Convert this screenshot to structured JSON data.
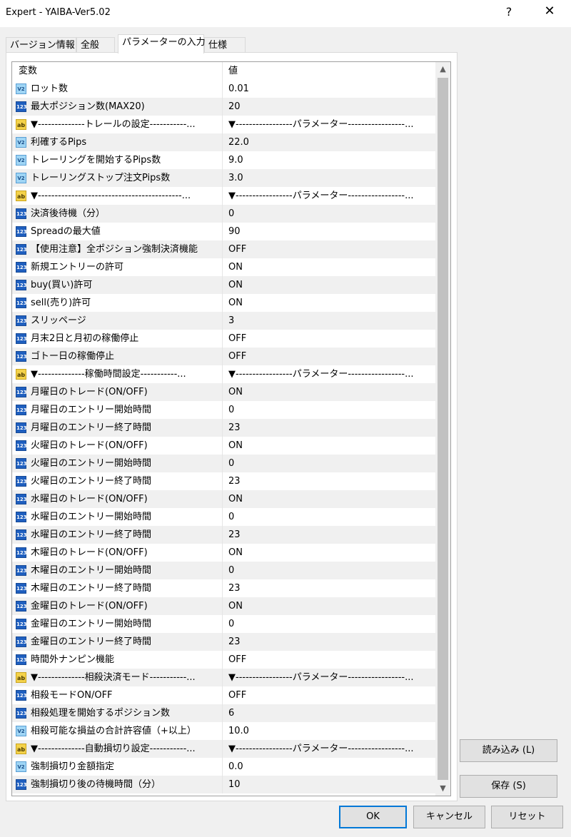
{
  "window": {
    "title": "Expert - YAIBA-Ver5.02",
    "help_glyph": "?",
    "close_glyph": "✕"
  },
  "tabs": [
    {
      "label": "バージョン情報",
      "active": false
    },
    {
      "label": "全般",
      "active": false
    },
    {
      "label": "パラメーターの入力",
      "active": true
    },
    {
      "label": "仕様",
      "active": false
    }
  ],
  "grid": {
    "headers": {
      "variable": "変数",
      "value": "値"
    },
    "rows": [
      {
        "type": "double",
        "icon_text": "V2",
        "name": "ロット数",
        "value": "0.01"
      },
      {
        "type": "int",
        "icon_text": "123",
        "name": "最大ポジション数(MAX20)",
        "value": "20"
      },
      {
        "type": "string",
        "icon_text": "ab",
        "name": "▼--------------トレールの設定-----------...",
        "value": "▼-----------------パラメーター-----------------..."
      },
      {
        "type": "double",
        "icon_text": "V2",
        "name": "利確するPips",
        "value": "22.0"
      },
      {
        "type": "double",
        "icon_text": "V2",
        "name": "トレーリングを開始するPips数",
        "value": "9.0"
      },
      {
        "type": "double",
        "icon_text": "V2",
        "name": "トレーリングストップ注文Pips数",
        "value": "3.0"
      },
      {
        "type": "string",
        "icon_text": "ab",
        "name": "▼-------------------------------------------...",
        "value": "▼-----------------パラメーター-----------------..."
      },
      {
        "type": "int",
        "icon_text": "123",
        "name": "決済後待機（分）",
        "value": "0"
      },
      {
        "type": "int",
        "icon_text": "123",
        "name": "Spreadの最大値",
        "value": "90"
      },
      {
        "type": "int",
        "icon_text": "123",
        "name": "【使用注意】全ポジション強制決済機能",
        "value": "OFF"
      },
      {
        "type": "int",
        "icon_text": "123",
        "name": "新規エントリーの許可",
        "value": "ON"
      },
      {
        "type": "int",
        "icon_text": "123",
        "name": "buy(買い)許可",
        "value": "ON"
      },
      {
        "type": "int",
        "icon_text": "123",
        "name": "sell(売り)許可",
        "value": "ON"
      },
      {
        "type": "int",
        "icon_text": "123",
        "name": "スリッページ",
        "value": "3"
      },
      {
        "type": "int",
        "icon_text": "123",
        "name": "月末2日と月初の稼働停止",
        "value": "OFF"
      },
      {
        "type": "int",
        "icon_text": "123",
        "name": "ゴトー日の稼働停止",
        "value": "OFF"
      },
      {
        "type": "string",
        "icon_text": "ab",
        "name": "▼--------------稼働時間設定-----------...",
        "value": "▼-----------------パラメーター-----------------..."
      },
      {
        "type": "int",
        "icon_text": "123",
        "name": "月曜日のトレード(ON/OFF)",
        "value": "ON"
      },
      {
        "type": "int",
        "icon_text": "123",
        "name": "月曜日のエントリー開始時間",
        "value": "0"
      },
      {
        "type": "int",
        "icon_text": "123",
        "name": "月曜日のエントリー終了時間",
        "value": "23"
      },
      {
        "type": "int",
        "icon_text": "123",
        "name": "火曜日のトレード(ON/OFF)",
        "value": "ON"
      },
      {
        "type": "int",
        "icon_text": "123",
        "name": "火曜日のエントリー開始時間",
        "value": "0"
      },
      {
        "type": "int",
        "icon_text": "123",
        "name": "火曜日のエントリー終了時間",
        "value": "23"
      },
      {
        "type": "int",
        "icon_text": "123",
        "name": "水曜日のトレード(ON/OFF)",
        "value": "ON"
      },
      {
        "type": "int",
        "icon_text": "123",
        "name": "水曜日のエントリー開始時間",
        "value": "0"
      },
      {
        "type": "int",
        "icon_text": "123",
        "name": "水曜日のエントリー終了時間",
        "value": "23"
      },
      {
        "type": "int",
        "icon_text": "123",
        "name": "木曜日のトレード(ON/OFF)",
        "value": "ON"
      },
      {
        "type": "int",
        "icon_text": "123",
        "name": "木曜日のエントリー開始時間",
        "value": "0"
      },
      {
        "type": "int",
        "icon_text": "123",
        "name": "木曜日のエントリー終了時間",
        "value": "23"
      },
      {
        "type": "int",
        "icon_text": "123",
        "name": "金曜日のトレード(ON/OFF)",
        "value": "ON"
      },
      {
        "type": "int",
        "icon_text": "123",
        "name": "金曜日のエントリー開始時間",
        "value": "0"
      },
      {
        "type": "int",
        "icon_text": "123",
        "name": "金曜日のエントリー終了時間",
        "value": "23"
      },
      {
        "type": "int",
        "icon_text": "123",
        "name": "時間外ナンピン機能",
        "value": "OFF"
      },
      {
        "type": "string",
        "icon_text": "ab",
        "name": "▼--------------相殺決済モード-----------...",
        "value": "▼-----------------パラメーター-----------------..."
      },
      {
        "type": "int",
        "icon_text": "123",
        "name": "相殺モードON/OFF",
        "value": "OFF"
      },
      {
        "type": "int",
        "icon_text": "123",
        "name": "相殺処理を開始するポジション数",
        "value": "6"
      },
      {
        "type": "double",
        "icon_text": "V2",
        "name": "相殺可能な損益の合計許容値（+以上）",
        "value": "10.0"
      },
      {
        "type": "string",
        "icon_text": "ab",
        "name": "▼--------------自動損切り設定-----------...",
        "value": "▼-----------------パラメーター-----------------..."
      },
      {
        "type": "double",
        "icon_text": "V2",
        "name": "強制損切り金額指定",
        "value": "0.0"
      },
      {
        "type": "int",
        "icon_text": "123",
        "name": "強制損切り後の待機時間（分）",
        "value": "10"
      }
    ]
  },
  "scrollbar": {
    "up_glyph": "▲",
    "down_glyph": "▼"
  },
  "side_buttons": {
    "load": "読み込み (L)",
    "save": "保存 (S)"
  },
  "footer_buttons": {
    "ok": "OK",
    "cancel": "キャンセル",
    "reset": "リセット"
  }
}
